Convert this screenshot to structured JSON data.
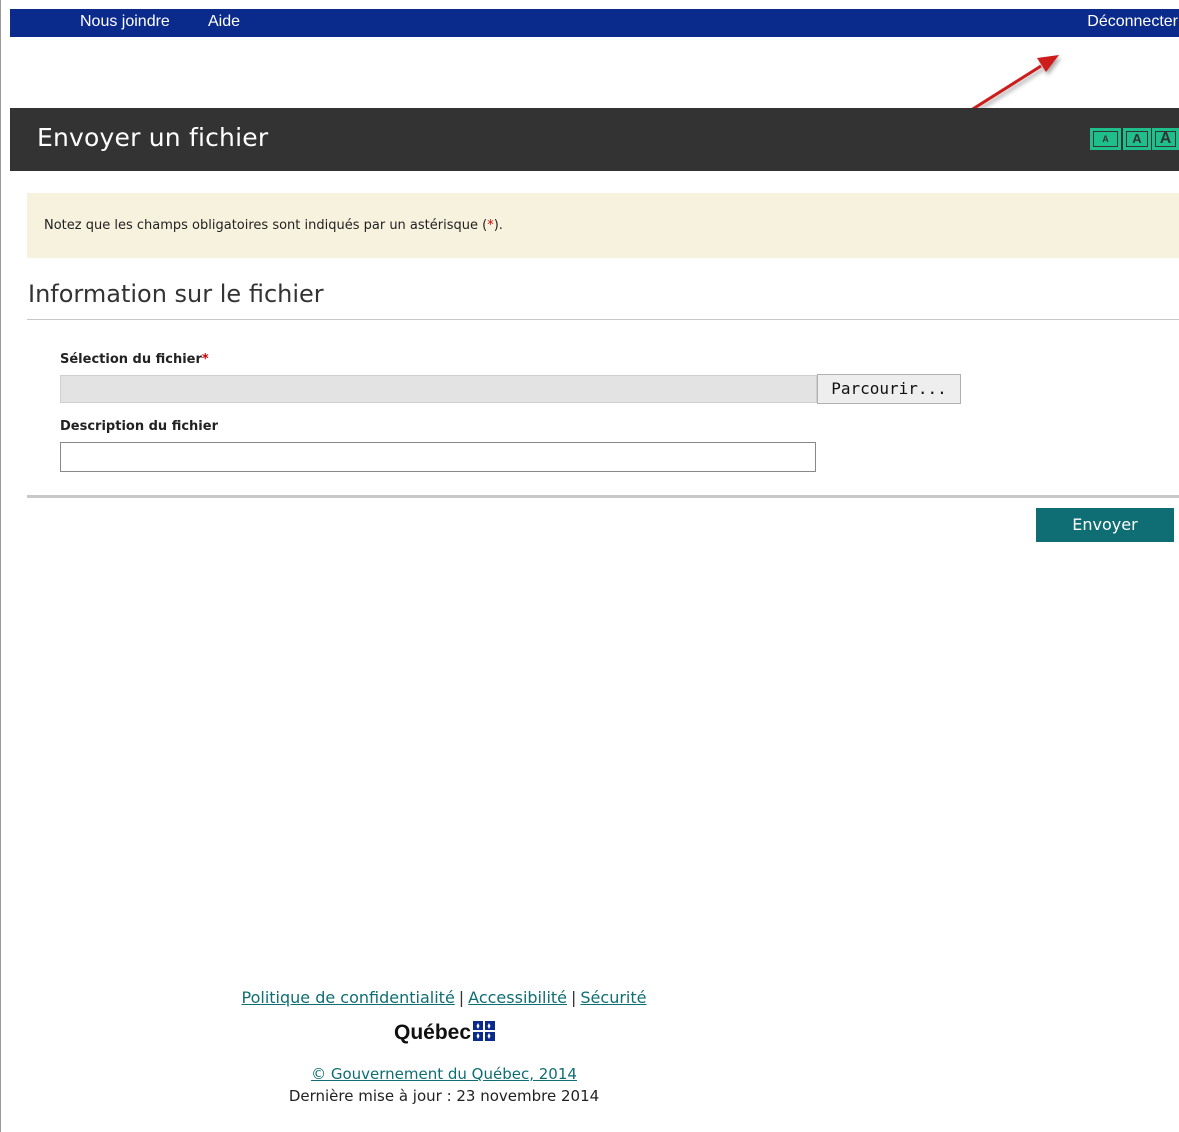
{
  "topnav": {
    "contact": "Nous joindre",
    "help": "Aide",
    "logout": "Déconnecter"
  },
  "title_bar": {
    "title": "Envoyer un fichier",
    "font_sizes": [
      "A",
      "A",
      "A"
    ]
  },
  "notice": {
    "text_before": "Notez que les champs obligatoires sont indiqués par un astérisque (",
    "asterisk": "*",
    "text_after": ")."
  },
  "section": {
    "title": "Information sur le fichier"
  },
  "form": {
    "file_label": "Sélection du fichier",
    "required_mark": "*",
    "file_value": "",
    "browse_button": "Parcourir...",
    "description_label": "Description du fichier",
    "description_value": "",
    "submit_button": "Envoyer"
  },
  "footer": {
    "links": [
      "Politique de confidentialité",
      "Accessibilité",
      "Sécurité"
    ],
    "separator": "|",
    "logo_text": "Québec",
    "copyright": "© Gouvernement du Québec, 2014",
    "last_update": "Dernière mise à jour : 23 novembre 2014"
  },
  "colors": {
    "topbar": "#0b2b8c",
    "titlebar": "#333333",
    "font_size_buttons": "#1fbf8c",
    "notice_bg": "#f7f2dd",
    "submit_button": "#0e6e73",
    "link": "#0e6e73",
    "required": "#cc0000",
    "annotation_arrow": "#cc1f1f"
  },
  "icons": {
    "logo_flag": "quebec-fleur-de-lis-flag-icon",
    "annotation": "red-arrow-annotation-icon"
  }
}
